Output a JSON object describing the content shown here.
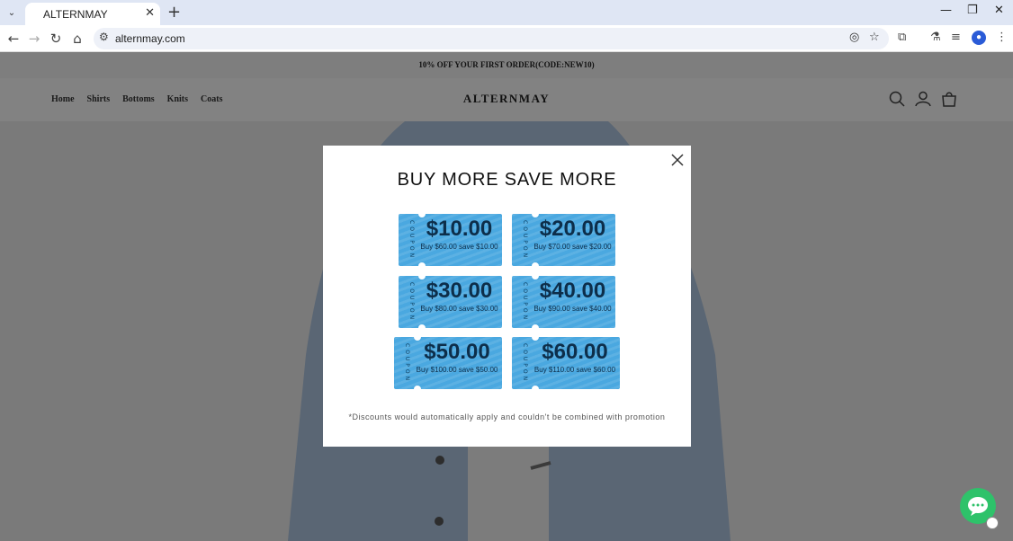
{
  "browser": {
    "tab_title": "ALTERNMAY",
    "url": "alternmay.com"
  },
  "announcement": "10% OFF YOUR FIRST ORDER(CODE:NEW10)",
  "nav": {
    "menu": [
      "Home",
      "Shirts",
      "Bottoms",
      "Knits",
      "Coats"
    ],
    "logo": "ALTERNMAY"
  },
  "modal": {
    "title": "BUY MORE SAVE MORE",
    "coupon_label": "COUPON",
    "coupons": [
      {
        "amount": "$10.00",
        "desc": "Buy $60.00 save $10.00"
      },
      {
        "amount": "$20.00",
        "desc": "Buy $70.00 save $20.00"
      },
      {
        "amount": "$30.00",
        "desc": "Buy $80.00 save $30.00"
      },
      {
        "amount": "$40.00",
        "desc": "Buy $90.00 save $40.00"
      },
      {
        "amount": "$50.00",
        "desc": "Buy $100.00 save $50.00"
      },
      {
        "amount": "$60.00",
        "desc": "Buy $110.00 save $60.00"
      }
    ],
    "note": "*Discounts would automatically apply and couldn't be combined with promotion"
  },
  "colors": {
    "coupon_blue": "#4aa8e0",
    "chat_green": "#2ec26a"
  }
}
